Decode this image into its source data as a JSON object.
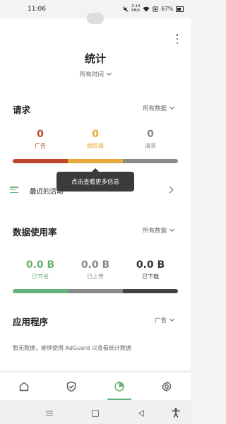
{
  "status_bar": {
    "time": "11:06",
    "network_speed_top": "3.14",
    "network_speed_bottom": "KB/s",
    "battery": "67%"
  },
  "header": {
    "title": "统计",
    "time_filter": "所有时间"
  },
  "requests": {
    "title": "请求",
    "filter": "所有数据",
    "stats": [
      {
        "value": "0",
        "label": "广告",
        "color": "#c0452d"
      },
      {
        "value": "0",
        "label": "跟踪器",
        "color": "#e8a93c"
      },
      {
        "value": "0",
        "label": "请求",
        "color": "#888888"
      }
    ],
    "bar_colors": [
      "#c0452d",
      "#e8a93c",
      "#8a8a8a"
    ]
  },
  "recent": {
    "label": "最近的活动"
  },
  "tooltip": {
    "text": "点击查看更多信息"
  },
  "data_usage": {
    "title": "数据使用率",
    "filter": "所有数据",
    "stats": [
      {
        "value": "0.0 B",
        "label": "已节省",
        "color": "#67b279"
      },
      {
        "value": "0.0 B",
        "label": "已上传",
        "color": "#888888"
      },
      {
        "value": "0.0 B",
        "label": "已下载",
        "color": "#333333"
      }
    ],
    "bar_colors": [
      "#67b279",
      "#8a8a8a",
      "#444444"
    ]
  },
  "apps": {
    "title": "应用程序",
    "filter": "广告",
    "empty_note": "暂无数据，继续使用 AdGuard 以查看统计数据"
  },
  "bottom_nav": {
    "items": [
      {
        "icon": "home-icon",
        "active": false
      },
      {
        "icon": "shield-check-icon",
        "active": false
      },
      {
        "icon": "statistics-icon",
        "active": true
      },
      {
        "icon": "gear-icon",
        "active": false
      }
    ],
    "accent": "#67b279"
  },
  "system_nav": {
    "icons": [
      "menu-icon",
      "home-square-icon",
      "back-triangle-icon",
      "accessibility-icon"
    ]
  }
}
